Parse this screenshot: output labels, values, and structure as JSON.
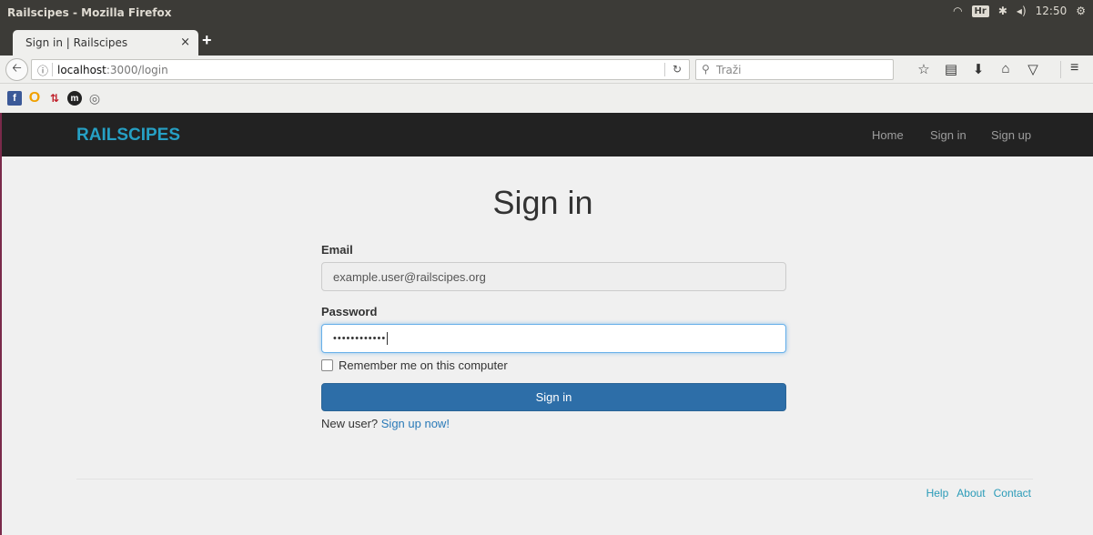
{
  "window": {
    "title": "Railscipes - Mozilla Firefox",
    "tray": {
      "keyboard_layout": "Hr",
      "clock": "12:50"
    }
  },
  "tabs": [
    {
      "label": "Sign in | Railscipes",
      "close": "×"
    }
  ],
  "new_tab": "+",
  "address_bar": {
    "host": "localhost",
    "path": ":3000/login"
  },
  "search_bar": {
    "placeholder": "Traži"
  },
  "toolbar_icons": [
    "bookmark-star-icon",
    "reading-list-icon",
    "download-icon",
    "home-icon",
    "pocket-icon",
    "menu-icon"
  ],
  "bookmarks": [
    "facebook-icon",
    "opera-icon",
    "arrows-icon",
    "m-icon",
    "globe-icon"
  ],
  "site": {
    "brand": "RAILSCIPES",
    "nav": {
      "home": "Home",
      "sign_in": "Sign in",
      "sign_up": "Sign up"
    }
  },
  "form": {
    "title": "Sign in",
    "email_label": "Email",
    "email_value": "example.user@railscipes.org",
    "password_label": "Password",
    "password_value": "••••••••••••",
    "remember_label": "Remember me on this computer",
    "submit_label": "Sign in",
    "new_user_text": "New user?",
    "signup_link": "Sign up now!"
  },
  "footer": {
    "help": "Help",
    "about": "About",
    "contact": "Contact"
  },
  "colors": {
    "brand": "#26a0c4",
    "primary_button": "#2d6ea8",
    "header_bg": "#222222",
    "link": "#2a7ab8"
  }
}
